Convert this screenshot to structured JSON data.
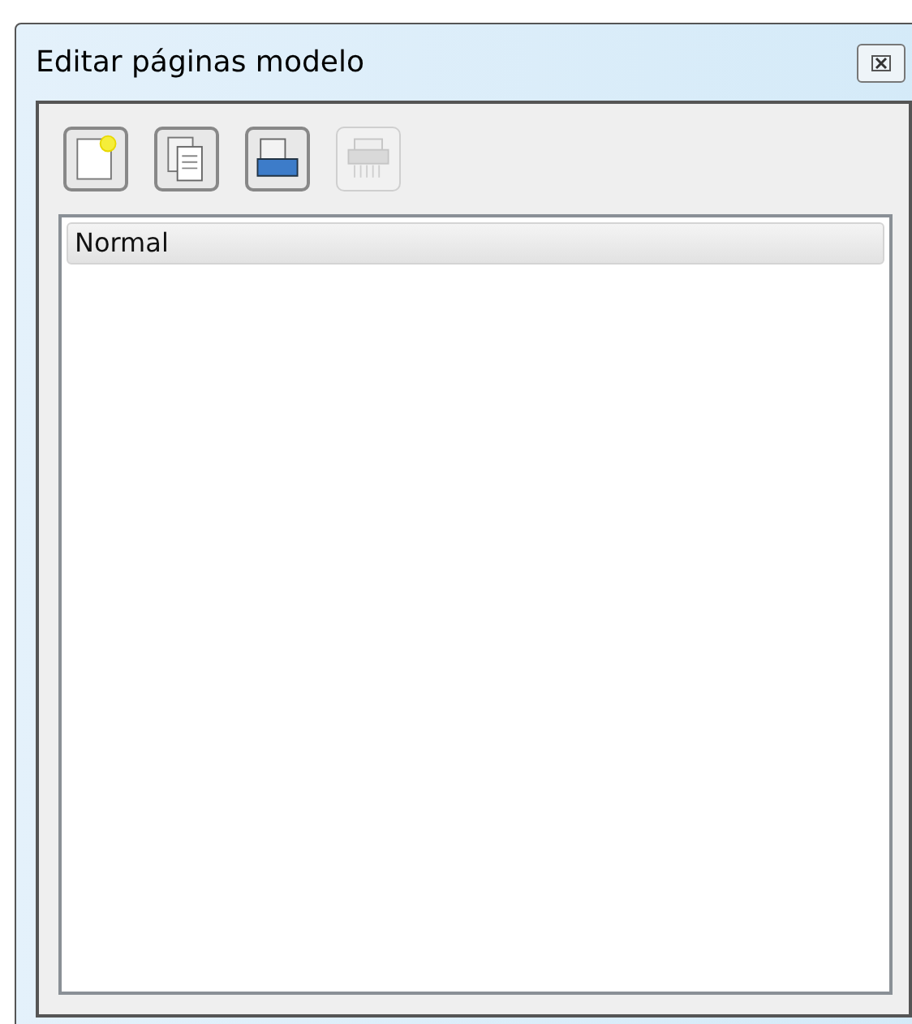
{
  "window": {
    "title": "Editar páginas modelo"
  },
  "toolbar": [
    {
      "kind": "new",
      "disabled": false
    },
    {
      "kind": "duplicate",
      "disabled": false
    },
    {
      "kind": "import",
      "disabled": false
    },
    {
      "kind": "delete",
      "disabled": true
    }
  ],
  "list": {
    "items": [
      {
        "label": "Normal",
        "selected": true
      }
    ]
  }
}
